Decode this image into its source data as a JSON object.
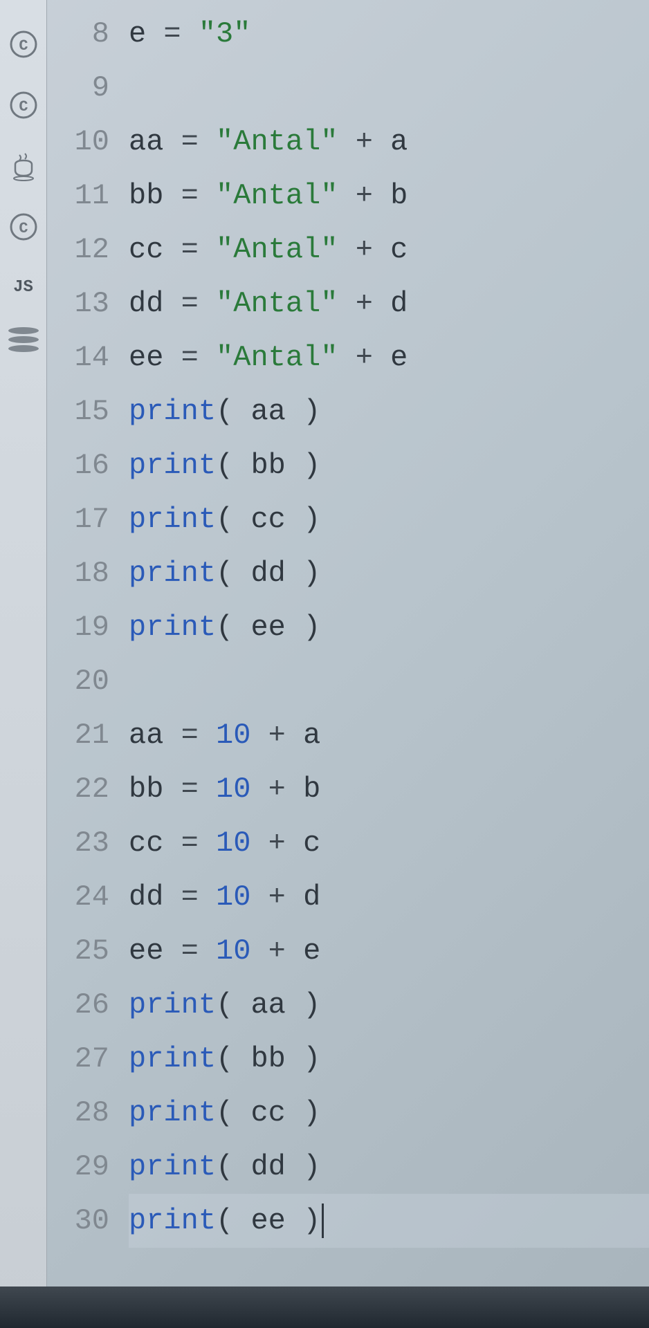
{
  "sidebar": {
    "icons": [
      {
        "name": "c-lang-icon",
        "label": "C"
      },
      {
        "name": "csharp-icon",
        "label": "C"
      },
      {
        "name": "java-icon",
        "label": "☕"
      },
      {
        "name": "cpp-icon",
        "label": "C"
      }
    ],
    "js_label": "JS"
  },
  "code": {
    "lines": [
      {
        "num": "8",
        "tokens": [
          {
            "t": "ident",
            "v": "e "
          },
          {
            "t": "op",
            "v": "= "
          },
          {
            "t": "string",
            "v": "\"3\""
          }
        ]
      },
      {
        "num": "9",
        "tokens": []
      },
      {
        "num": "10",
        "tokens": [
          {
            "t": "ident",
            "v": "aa "
          },
          {
            "t": "op",
            "v": "= "
          },
          {
            "t": "string",
            "v": "\"Antal\""
          },
          {
            "t": "op",
            "v": " + "
          },
          {
            "t": "ident",
            "v": "a"
          }
        ]
      },
      {
        "num": "11",
        "tokens": [
          {
            "t": "ident",
            "v": "bb "
          },
          {
            "t": "op",
            "v": "= "
          },
          {
            "t": "string",
            "v": "\"Antal\""
          },
          {
            "t": "op",
            "v": " + "
          },
          {
            "t": "ident",
            "v": "b"
          }
        ]
      },
      {
        "num": "12",
        "tokens": [
          {
            "t": "ident",
            "v": "cc "
          },
          {
            "t": "op",
            "v": "= "
          },
          {
            "t": "string",
            "v": "\"Antal\""
          },
          {
            "t": "op",
            "v": " + "
          },
          {
            "t": "ident",
            "v": "c"
          }
        ]
      },
      {
        "num": "13",
        "tokens": [
          {
            "t": "ident",
            "v": "dd "
          },
          {
            "t": "op",
            "v": "= "
          },
          {
            "t": "string",
            "v": "\"Antal\""
          },
          {
            "t": "op",
            "v": " + "
          },
          {
            "t": "ident",
            "v": "d"
          }
        ]
      },
      {
        "num": "14",
        "tokens": [
          {
            "t": "ident",
            "v": "ee "
          },
          {
            "t": "op",
            "v": "= "
          },
          {
            "t": "string",
            "v": "\"Antal\""
          },
          {
            "t": "op",
            "v": " + "
          },
          {
            "t": "ident",
            "v": "e"
          }
        ]
      },
      {
        "num": "15",
        "tokens": [
          {
            "t": "func",
            "v": "print"
          },
          {
            "t": "paren",
            "v": "( "
          },
          {
            "t": "ident",
            "v": "aa"
          },
          {
            "t": "paren",
            "v": " )"
          }
        ]
      },
      {
        "num": "16",
        "tokens": [
          {
            "t": "func",
            "v": "print"
          },
          {
            "t": "paren",
            "v": "( "
          },
          {
            "t": "ident",
            "v": "bb"
          },
          {
            "t": "paren",
            "v": " )"
          }
        ]
      },
      {
        "num": "17",
        "tokens": [
          {
            "t": "func",
            "v": "print"
          },
          {
            "t": "paren",
            "v": "( "
          },
          {
            "t": "ident",
            "v": "cc"
          },
          {
            "t": "paren",
            "v": " )"
          }
        ]
      },
      {
        "num": "18",
        "tokens": [
          {
            "t": "func",
            "v": "print"
          },
          {
            "t": "paren",
            "v": "( "
          },
          {
            "t": "ident",
            "v": "dd"
          },
          {
            "t": "paren",
            "v": " )"
          }
        ]
      },
      {
        "num": "19",
        "tokens": [
          {
            "t": "func",
            "v": "print"
          },
          {
            "t": "paren",
            "v": "( "
          },
          {
            "t": "ident",
            "v": "ee"
          },
          {
            "t": "paren",
            "v": " )"
          }
        ]
      },
      {
        "num": "20",
        "tokens": []
      },
      {
        "num": "21",
        "tokens": [
          {
            "t": "ident",
            "v": "aa "
          },
          {
            "t": "op",
            "v": "= "
          },
          {
            "t": "number",
            "v": "10"
          },
          {
            "t": "op",
            "v": " + "
          },
          {
            "t": "ident",
            "v": "a"
          }
        ]
      },
      {
        "num": "22",
        "tokens": [
          {
            "t": "ident",
            "v": "bb "
          },
          {
            "t": "op",
            "v": "= "
          },
          {
            "t": "number",
            "v": "10"
          },
          {
            "t": "op",
            "v": " + "
          },
          {
            "t": "ident",
            "v": "b"
          }
        ]
      },
      {
        "num": "23",
        "tokens": [
          {
            "t": "ident",
            "v": "cc "
          },
          {
            "t": "op",
            "v": "= "
          },
          {
            "t": "number",
            "v": "10"
          },
          {
            "t": "op",
            "v": " + "
          },
          {
            "t": "ident",
            "v": "c"
          }
        ]
      },
      {
        "num": "24",
        "tokens": [
          {
            "t": "ident",
            "v": "dd "
          },
          {
            "t": "op",
            "v": "= "
          },
          {
            "t": "number",
            "v": "10"
          },
          {
            "t": "op",
            "v": " + "
          },
          {
            "t": "ident",
            "v": "d"
          }
        ]
      },
      {
        "num": "25",
        "tokens": [
          {
            "t": "ident",
            "v": "ee "
          },
          {
            "t": "op",
            "v": "= "
          },
          {
            "t": "number",
            "v": "10"
          },
          {
            "t": "op",
            "v": " + "
          },
          {
            "t": "ident",
            "v": "e"
          }
        ]
      },
      {
        "num": "26",
        "tokens": [
          {
            "t": "func",
            "v": "print"
          },
          {
            "t": "paren",
            "v": "( "
          },
          {
            "t": "ident",
            "v": "aa"
          },
          {
            "t": "paren",
            "v": " )"
          }
        ]
      },
      {
        "num": "27",
        "tokens": [
          {
            "t": "func",
            "v": "print"
          },
          {
            "t": "paren",
            "v": "( "
          },
          {
            "t": "ident",
            "v": "bb"
          },
          {
            "t": "paren",
            "v": " )"
          }
        ]
      },
      {
        "num": "28",
        "tokens": [
          {
            "t": "func",
            "v": "print"
          },
          {
            "t": "paren",
            "v": "( "
          },
          {
            "t": "ident",
            "v": "cc"
          },
          {
            "t": "paren",
            "v": " )"
          }
        ]
      },
      {
        "num": "29",
        "tokens": [
          {
            "t": "func",
            "v": "print"
          },
          {
            "t": "paren",
            "v": "( "
          },
          {
            "t": "ident",
            "v": "dd"
          },
          {
            "t": "paren",
            "v": " )"
          }
        ]
      },
      {
        "num": "30",
        "tokens": [
          {
            "t": "func",
            "v": "print"
          },
          {
            "t": "paren",
            "v": "( "
          },
          {
            "t": "ident",
            "v": "ee"
          },
          {
            "t": "paren",
            "v": " )"
          }
        ],
        "cursor": true,
        "current": true
      }
    ]
  }
}
